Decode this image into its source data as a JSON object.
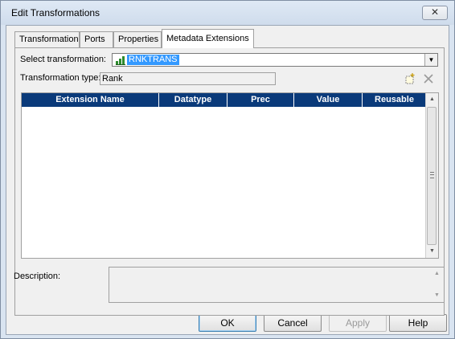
{
  "window": {
    "title": "Edit Transformations",
    "close_glyph": "✕"
  },
  "tabs": [
    {
      "label": "Transformation",
      "active": false
    },
    {
      "label": "Ports",
      "active": false
    },
    {
      "label": "Properties",
      "active": false
    },
    {
      "label": "Metadata Extensions",
      "active": true
    }
  ],
  "form": {
    "select_label": "Select transformation:",
    "select_value": "RNKTRANS",
    "type_label": "Transformation type:",
    "type_value": "Rank"
  },
  "grid": {
    "columns": [
      "Extension Name",
      "Datatype",
      "Prec",
      "Value",
      "Reusable"
    ],
    "rows": []
  },
  "description": {
    "label": "Description:",
    "value": ""
  },
  "buttons": {
    "ok": "OK",
    "cancel": "Cancel",
    "apply": "Apply",
    "help": "Help"
  },
  "icons": {
    "new": "new-item-icon",
    "delete": "delete-icon",
    "transformation": "rank-transformation-icon"
  },
  "colors": {
    "header_bg": "#0a3a7a",
    "selection": "#3399ff"
  }
}
